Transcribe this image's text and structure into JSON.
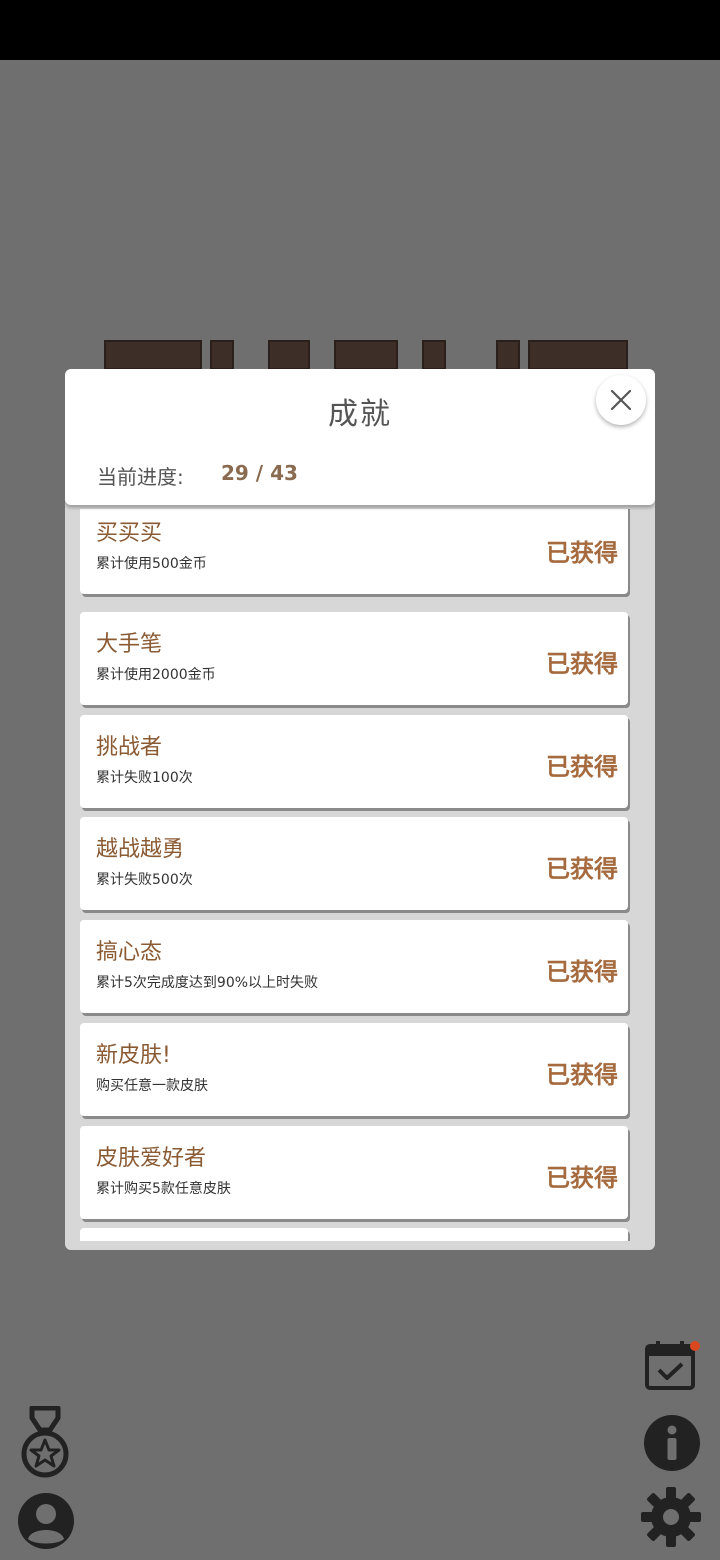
{
  "dialog": {
    "title": "成就",
    "progress_label": "当前进度:",
    "progress_value": "29 / 43"
  },
  "achievements": [
    {
      "title": "买买买",
      "desc": "累计使用500金币",
      "status": "已获得"
    },
    {
      "title": "大手笔",
      "desc": "累计使用2000金币",
      "status": "已获得"
    },
    {
      "title": "挑战者",
      "desc": "累计失败100次",
      "status": "已获得"
    },
    {
      "title": "越战越勇",
      "desc": "累计失败500次",
      "status": "已获得"
    },
    {
      "title": "搞心态",
      "desc": "累计5次完成度达到90%以上时失败",
      "status": "已获得"
    },
    {
      "title": "新皮肤!",
      "desc": "购买任意一款皮肤",
      "status": "已获得"
    },
    {
      "title": "皮肤爱好者",
      "desc": "累计购买5款任意皮肤",
      "status": "已获得"
    }
  ],
  "icons": {
    "close": "close-icon",
    "medal": "medal-icon",
    "profile": "profile-icon",
    "calendar": "calendar-check-icon",
    "info": "info-icon",
    "settings": "gear-icon"
  },
  "colors": {
    "accent": "#a56b3f",
    "title_brown": "#8a5a33",
    "notification": "#d9481f"
  }
}
